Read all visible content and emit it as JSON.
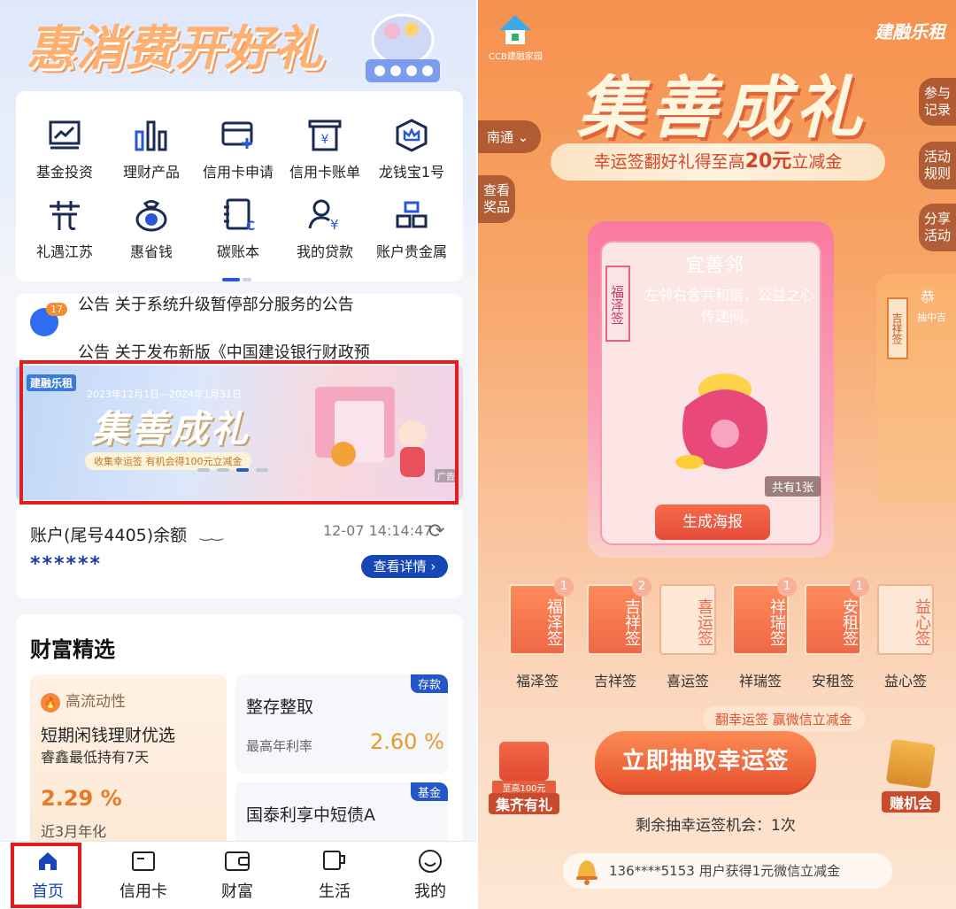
{
  "left": {
    "banner_title": "惠消费开好礼",
    "icons_row1": [
      {
        "label": "基金投资",
        "icon": "fund-chart-icon"
      },
      {
        "label": "理财产品",
        "icon": "bar-chart-icon"
      },
      {
        "label": "信用卡申请",
        "icon": "credit-card-add-icon"
      },
      {
        "label": "信用卡账单",
        "icon": "bill-icon"
      },
      {
        "label": "龙钱宝1号",
        "icon": "crown-hexagon-icon"
      }
    ],
    "icons_row2": [
      {
        "label": "礼遇江苏",
        "icon": "gift-icon"
      },
      {
        "label": "惠省钱",
        "icon": "money-bag-icon"
      },
      {
        "label": "碳账本",
        "icon": "carbon-book-icon"
      },
      {
        "label": "我的贷款",
        "icon": "user-loan-icon"
      },
      {
        "label": "账户贵金属",
        "icon": "gold-bars-icon"
      }
    ],
    "notice": {
      "badge": "17",
      "line1": "公告  关于系统升级暂停部分服务的公告",
      "line2": "公告  关于发布新版《中国建设银行财政预"
    },
    "ad": {
      "logo": "建融乐租",
      "date": "2023年12月1日—2024年1月31日",
      "title": "集善成礼",
      "sub": "收集幸运签 有机会得100元立减金",
      "tag": "广告"
    },
    "account": {
      "label": "账户(尾号4405)余额",
      "eye": "‿‿",
      "time": "12-07 14:14:47",
      "stars": "******",
      "detail_btn": "查看详情"
    },
    "wealth": {
      "title": "财富精选",
      "prod_a": {
        "tag": "高流动性",
        "name": "短期闲钱理财优选",
        "desc": "睿鑫最低持有7天",
        "rate": "2.29 %",
        "rate_label": "近3月年化"
      },
      "prod_b1": {
        "badge": "存款",
        "name": "整存整取",
        "rate_label": "最高年利率",
        "rate": "2.60 %"
      },
      "prod_b2": {
        "badge": "基金",
        "name": "国泰利享中短债A"
      }
    },
    "tabs": [
      {
        "label": "首页",
        "icon": "home-icon"
      },
      {
        "label": "信用卡",
        "icon": "credit-card-icon"
      },
      {
        "label": "财富",
        "icon": "wallet-icon"
      },
      {
        "label": "生活",
        "icon": "cup-icon"
      },
      {
        "label": "我的",
        "icon": "smiley-icon"
      }
    ]
  },
  "right": {
    "logo_text": "CCB建融家园",
    "brand": "建融乐租",
    "title": "集善成礼",
    "sub_prefix": "幸运签翻好礼得至高",
    "sub_amount": "20元",
    "sub_suffix": "立减金",
    "city": "南通",
    "side_view_prize": "查看\n奖品",
    "side_record": "参与\n记录",
    "side_rules": "活动\n规则",
    "side_share": "分享\n活动",
    "card": {
      "vert_label": "福泽签",
      "heading": "宜善邻",
      "text": "左邻右舍共和谐，公益之心传递间。",
      "count": "共有1张",
      "button": "生成海报"
    },
    "card_side": {
      "vert_label": "吉祥签",
      "head": "恭",
      "text": "抽中吉"
    },
    "signs": [
      {
        "tile": "福泽签",
        "label": "福泽签",
        "count": "1",
        "active": true
      },
      {
        "tile": "吉祥签",
        "label": "吉祥签",
        "count": "2",
        "active": true
      },
      {
        "tile": "喜运签",
        "label": "喜运签",
        "count": "",
        "active": false
      },
      {
        "tile": "祥瑞签",
        "label": "祥瑞签",
        "count": "1",
        "active": true
      },
      {
        "tile": "安租签",
        "label": "安租签",
        "count": "1",
        "active": true
      },
      {
        "tile": "益心签",
        "label": "益心签",
        "count": "",
        "active": false
      }
    ],
    "promo": "翻幸运签 赢微信立减金",
    "draw_button": "立即抽取幸运签",
    "left_icon_top": "至高100元",
    "left_icon_label": "集齐有礼",
    "right_icon_label": "赚机会",
    "remain": "剩余抽幸运签机会：1次",
    "marquee": "136****5153 用户获得1元微信立减金"
  }
}
